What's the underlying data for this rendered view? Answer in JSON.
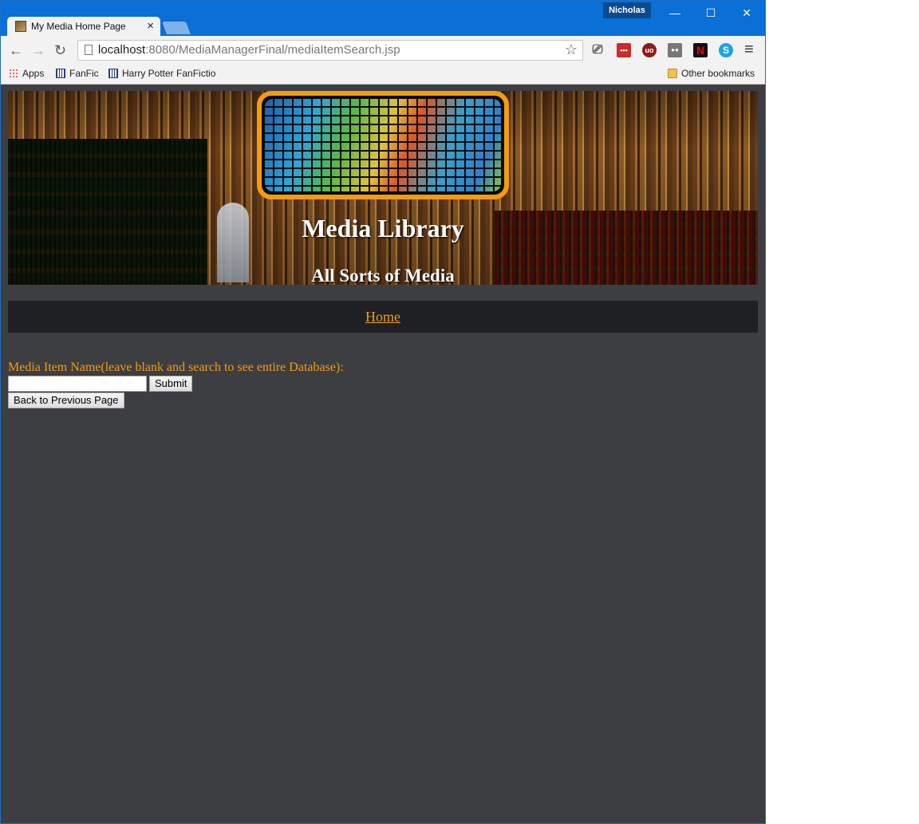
{
  "browser": {
    "tab_title": "My Media Home Page",
    "tab_close": "×",
    "user": "Nicholas",
    "minimize": "—",
    "maximize": "☐",
    "close": "✕",
    "back": "←",
    "forward": "→",
    "reload": "↻",
    "url_host": "localhost",
    "url_rest": ":8080/MediaManagerFinal/mediaItemSearch.jsp",
    "star": "☆",
    "menu": "≡",
    "extensions": [
      {
        "icon": "cast-icon",
        "label": "⎚"
      },
      {
        "icon": "lastpass-icon",
        "label": "•••"
      },
      {
        "icon": "ublock-icon",
        "label": "uo"
      },
      {
        "icon": "ghostery-icon",
        "label": "●●"
      },
      {
        "icon": "netflix-icon",
        "label": "N"
      },
      {
        "icon": "skype-icon",
        "label": "S"
      }
    ]
  },
  "bookmarks": {
    "apps": "Apps",
    "fanfic": "FanFic",
    "hp_fanfic": "Harry Potter FanFictio",
    "other": "Other bookmarks"
  },
  "page": {
    "title": "Media Library",
    "subtitle": "All Sorts of Media",
    "nav_home": "Home",
    "search_label": "Media Item Name(leave blank and search to see entire Database):",
    "search_value": "",
    "submit_label": "Submit",
    "back_label": "Back to Previous Page"
  }
}
